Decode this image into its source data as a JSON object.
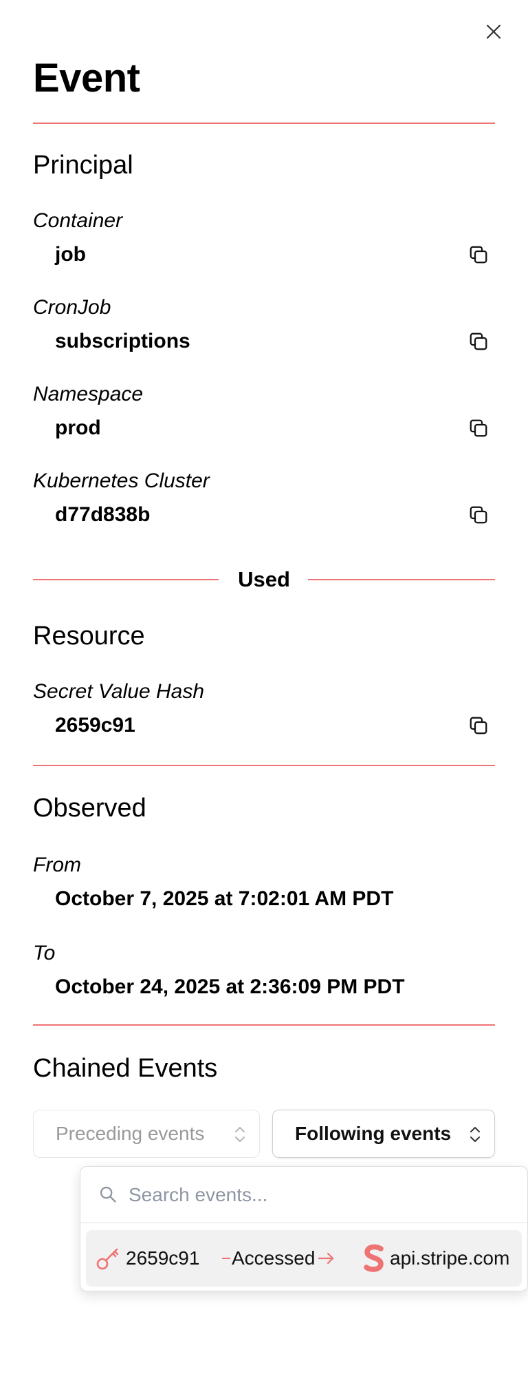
{
  "header": {
    "title": "Event"
  },
  "principal": {
    "title": "Principal",
    "fields": [
      {
        "label": "Container",
        "value": "job"
      },
      {
        "label": "CronJob",
        "value": "subscriptions"
      },
      {
        "label": "Namespace",
        "value": "prod"
      },
      {
        "label": "Kubernetes Cluster",
        "value": "d77d838b"
      }
    ]
  },
  "relation": {
    "label": "Used"
  },
  "resource": {
    "title": "Resource",
    "fields": [
      {
        "label": "Secret Value Hash",
        "value": "2659c91"
      }
    ]
  },
  "observed": {
    "title": "Observed",
    "from_label": "From",
    "from_value": "October 7, 2025 at 7:02:01 AM PDT",
    "to_label": "To",
    "to_value": "October 24, 2025 at 2:36:09 PM PDT"
  },
  "chained": {
    "title": "Chained Events",
    "preceding_label": "Preceding events",
    "following_label": "Following events",
    "search_placeholder": "Search events...",
    "results": [
      {
        "source": "2659c91",
        "action": "Accessed",
        "target": "api.stripe.com"
      }
    ]
  },
  "colors": {
    "accent": "#ee7373",
    "stripe_logo": "#ee7373"
  },
  "icons": {
    "close": "close-icon",
    "copy": "copy-icon",
    "search": "search-icon",
    "key": "key-icon",
    "chevron": "chevron-up-down-icon",
    "stripe": "stripe-logo-icon"
  }
}
